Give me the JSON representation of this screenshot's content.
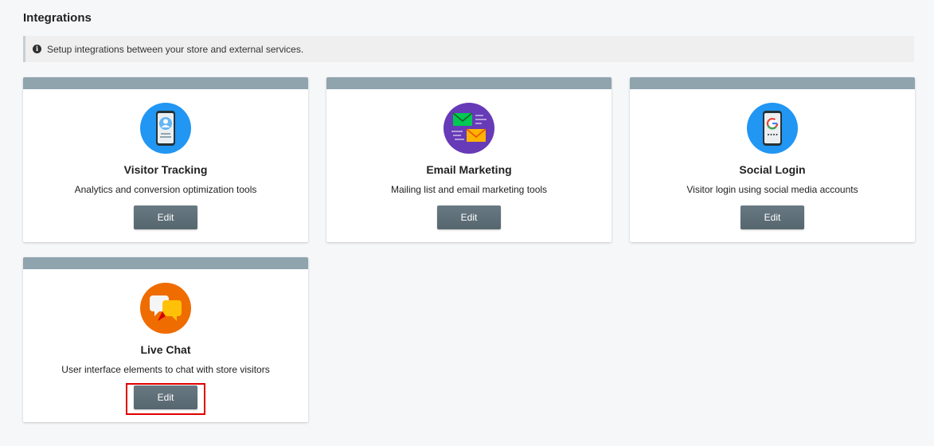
{
  "page": {
    "title": "Integrations"
  },
  "info": {
    "icon": "info-icon",
    "text": "Setup integrations between your store and external services."
  },
  "cards": [
    {
      "title": "Visitor Tracking",
      "description": "Analytics and conversion optimization tools",
      "edit_label": "Edit",
      "icon": "visitor-tracking-icon"
    },
    {
      "title": "Email Marketing",
      "description": "Mailing list and email marketing tools",
      "edit_label": "Edit",
      "icon": "email-marketing-icon"
    },
    {
      "title": "Social Login",
      "description": "Visitor login using social media accounts",
      "edit_label": "Edit",
      "icon": "social-login-icon"
    },
    {
      "title": "Live Chat",
      "description": "User interface elements to chat with store visitors",
      "edit_label": "Edit",
      "icon": "live-chat-icon",
      "highlighted": true
    }
  ],
  "colors": {
    "card_header": "#90a4ae",
    "button": "#5f6f78",
    "highlight": "#e00000"
  }
}
